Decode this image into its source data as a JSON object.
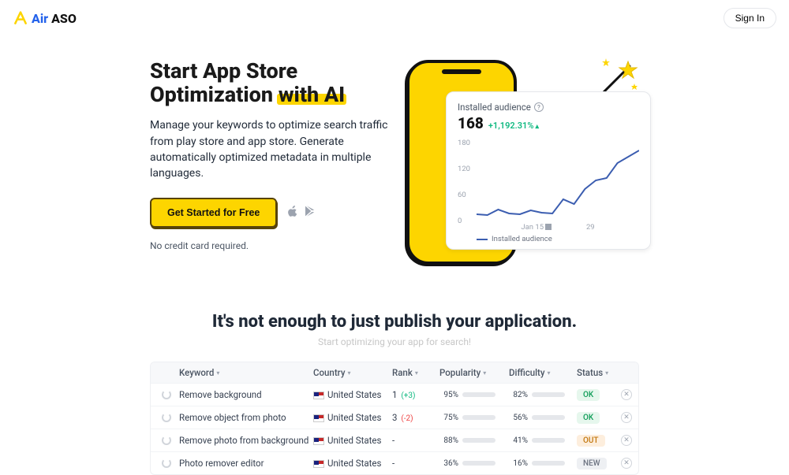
{
  "header": {
    "logo_air": "Air",
    "logo_aso": "ASO",
    "signin": "Sign In"
  },
  "hero": {
    "title_l1": "Start App Store",
    "title_l2a": "Optimization ",
    "title_l2b": "with AI",
    "desc": "Manage your keywords to optimize search traffic from play store and app store. Generate automatically optimized metadata in multiple languages.",
    "cta": "Get Started for Free",
    "nocard": "No credit card required."
  },
  "card": {
    "title": "Installed audience",
    "value": "168",
    "delta": "+1,192.31%",
    "y_180": "180",
    "y_120": "120",
    "y_60": "60",
    "y_0": "0",
    "x_jan15": "Jan 15",
    "x_29": "29",
    "legend": "Installed audience"
  },
  "chart_data": {
    "type": "line",
    "title": "Installed audience",
    "ylabel": "",
    "xlabel": "",
    "ylim": [
      0,
      180
    ],
    "x": [
      "~Jan 1",
      "~Jan 3",
      "~Jan 5",
      "~Jan 7",
      "~Jan 9",
      "~Jan 11",
      "~Jan 13",
      "Jan 15",
      "~Jan 17",
      "~Jan 19",
      "~Jan 21",
      "~Jan 23",
      "~Jan 25",
      "~Jan 27",
      "29",
      "~Jan 31"
    ],
    "series": [
      {
        "name": "Installed audience",
        "values": [
          10,
          8,
          22,
          12,
          10,
          20,
          14,
          12,
          45,
          35,
          70,
          90,
          95,
          130,
          145,
          160
        ]
      }
    ],
    "legend": [
      "Installed audience"
    ]
  },
  "section2": {
    "title": "It's not enough to just publish your application.",
    "subtitle": "Start optimizing your app for search!"
  },
  "table": {
    "headers": {
      "keyword": "Keyword",
      "country": "Country",
      "rank": "Rank",
      "popularity": "Popularity",
      "difficulty": "Difficulty",
      "status": "Status"
    },
    "rows": [
      {
        "keyword": "Remove background",
        "country": "United States",
        "rank": "1",
        "rank_delta": "(+3)",
        "rank_delta_dir": "up",
        "popularity_pct": "95%",
        "popularity_fill": 95,
        "popularity_color": "green",
        "difficulty_pct": "82%",
        "difficulty_fill": 82,
        "difficulty_color": "red",
        "status": "OK",
        "status_kind": "ok"
      },
      {
        "keyword": "Remove object from photo",
        "country": "United States",
        "rank": "3",
        "rank_delta": "(-2)",
        "rank_delta_dir": "down",
        "popularity_pct": "75%",
        "popularity_fill": 75,
        "popularity_color": "green",
        "difficulty_pct": "56%",
        "difficulty_fill": 56,
        "difficulty_color": "yellow",
        "status": "OK",
        "status_kind": "ok"
      },
      {
        "keyword": "Remove photo from background",
        "country": "United States",
        "rank": "-",
        "rank_delta": "",
        "rank_delta_dir": "",
        "popularity_pct": "88%",
        "popularity_fill": 88,
        "popularity_color": "green",
        "difficulty_pct": "41%",
        "difficulty_fill": 41,
        "difficulty_color": "yellow",
        "status": "OUT",
        "status_kind": "out"
      },
      {
        "keyword": "Photo remover editor",
        "country": "United States",
        "rank": "-",
        "rank_delta": "",
        "rank_delta_dir": "",
        "popularity_pct": "36%",
        "popularity_fill": 36,
        "popularity_color": "yellow",
        "difficulty_pct": "16%",
        "difficulty_fill": 16,
        "difficulty_color": "yellow",
        "status": "NEW",
        "status_kind": "new"
      }
    ]
  }
}
